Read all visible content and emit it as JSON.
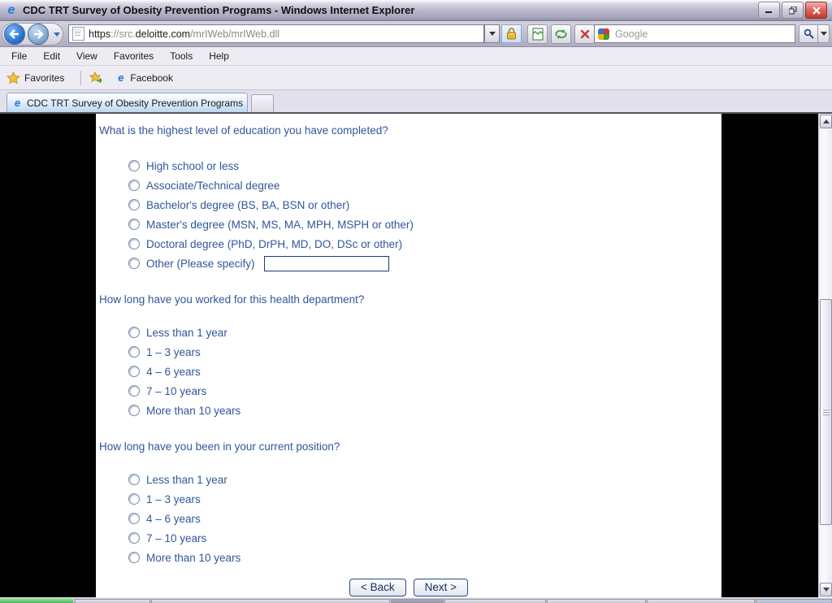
{
  "window": {
    "title": "CDC TRT Survey of Obesity Prevention Programs - Windows Internet Explorer"
  },
  "navbar": {
    "address": {
      "scheme": "https",
      "separator": "://src.",
      "domain": "deloitte.com",
      "path": "/mrIWeb/mrIWeb.dll"
    },
    "search": {
      "placeholder": "Google"
    }
  },
  "menubar": {
    "items": [
      "File",
      "Edit",
      "View",
      "Favorites",
      "Tools",
      "Help"
    ]
  },
  "favorites_bar": {
    "favorites_label": "Favorites",
    "links": [
      "Facebook"
    ]
  },
  "tabs": {
    "active_label": "CDC TRT Survey of Obesity Prevention Programs"
  },
  "survey": {
    "questions": [
      {
        "text": "What is the highest level of education you have completed?",
        "options": [
          "High school or less",
          "Associate/Technical degree",
          "Bachelor's degree (BS, BA, BSN or other)",
          "Master's degree (MSN, MS, MA, MPH, MSPH or other)",
          "Doctoral degree (PhD, DrPH, MD, DO, DSc or other)",
          "Other (Please specify)"
        ],
        "other_input_value": ""
      },
      {
        "text": "How long have you worked for this health department?",
        "options": [
          "Less than 1 year",
          "1 – 3 years",
          "4 – 6 years",
          "7 – 10 years",
          "More than 10 years"
        ]
      },
      {
        "text": "How long have you been in your current position?",
        "options": [
          "Less than 1 year",
          "1 – 3 years",
          "4 – 6 years",
          "7 – 10 years",
          "More than 10 years"
        ]
      }
    ],
    "back_label": "< Back",
    "next_label": "Next >"
  },
  "icons": {
    "ie_glyph": "e"
  },
  "colors": {
    "survey_text": "#31569A",
    "page_background": "#FFFFFF",
    "content_margin": "#000000",
    "close_button_red": "#C53A2D",
    "start_button_green": "#3CB54A",
    "lock_gold": "#D8A62A",
    "active_tab_blue": "#BCD6F0"
  }
}
